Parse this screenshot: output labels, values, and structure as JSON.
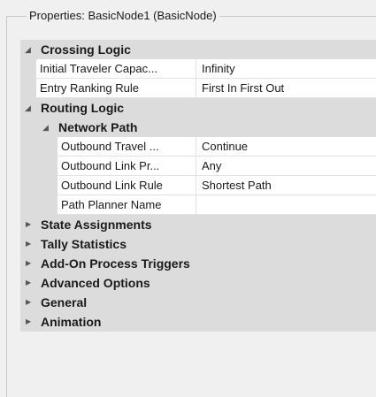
{
  "panel": {
    "title": "Properties: BasicNode1 (BasicNode)"
  },
  "categories": {
    "crossing_logic": {
      "label": "Crossing Logic",
      "props": [
        {
          "name": "Initial Traveler Capac...",
          "value": "Infinity"
        },
        {
          "name": "Entry Ranking Rule",
          "value": "First In First Out"
        }
      ]
    },
    "routing_logic": {
      "label": "Routing Logic",
      "network_path": {
        "label": "Network Path",
        "props": [
          {
            "name": "Outbound Travel ...",
            "value": "Continue"
          },
          {
            "name": "Outbound Link Pr...",
            "value": "Any"
          },
          {
            "name": "Outbound Link Rule",
            "value": "Shortest Path"
          },
          {
            "name": "Path Planner Name",
            "value": ""
          }
        ]
      }
    },
    "collapsed": [
      "State Assignments",
      "Tally Statistics",
      "Add-On Process Triggers",
      "Advanced Options",
      "General",
      "Animation"
    ]
  },
  "icons": {
    "expanded": "triangle-down-icon",
    "collapsed": "triangle-right-icon"
  },
  "colors": {
    "category_bg": "#dcdcdc",
    "value_bg": "#ffffff",
    "window_bg": "#f0f0f0"
  }
}
